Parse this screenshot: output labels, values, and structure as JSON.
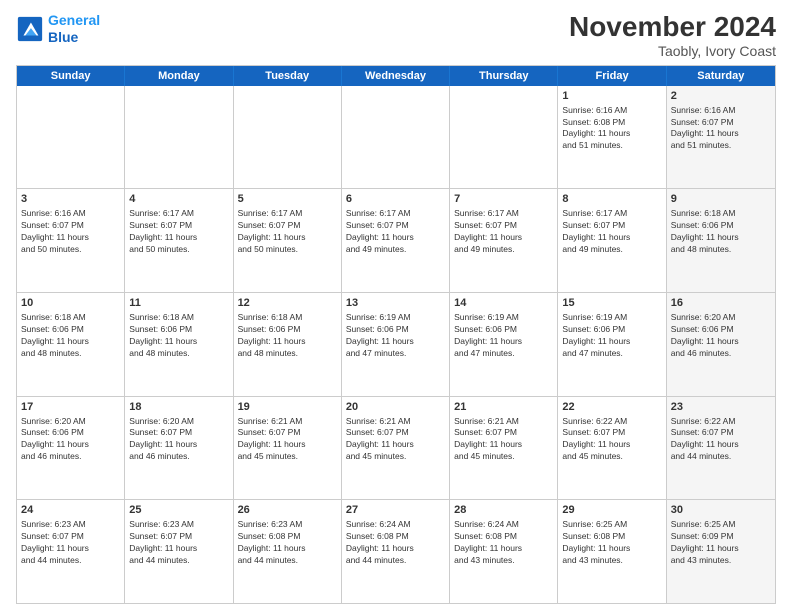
{
  "logo": {
    "line1": "General",
    "line2": "Blue"
  },
  "title": "November 2024",
  "subtitle": "Taobly, Ivory Coast",
  "weekdays": [
    "Sunday",
    "Monday",
    "Tuesday",
    "Wednesday",
    "Thursday",
    "Friday",
    "Saturday"
  ],
  "rows": [
    [
      {
        "day": "",
        "info": "",
        "shaded": false
      },
      {
        "day": "",
        "info": "",
        "shaded": false
      },
      {
        "day": "",
        "info": "",
        "shaded": false
      },
      {
        "day": "",
        "info": "",
        "shaded": false
      },
      {
        "day": "",
        "info": "",
        "shaded": false
      },
      {
        "day": "1",
        "info": "Sunrise: 6:16 AM\nSunset: 6:08 PM\nDaylight: 11 hours\nand 51 minutes.",
        "shaded": false
      },
      {
        "day": "2",
        "info": "Sunrise: 6:16 AM\nSunset: 6:07 PM\nDaylight: 11 hours\nand 51 minutes.",
        "shaded": true
      }
    ],
    [
      {
        "day": "3",
        "info": "Sunrise: 6:16 AM\nSunset: 6:07 PM\nDaylight: 11 hours\nand 50 minutes.",
        "shaded": false
      },
      {
        "day": "4",
        "info": "Sunrise: 6:17 AM\nSunset: 6:07 PM\nDaylight: 11 hours\nand 50 minutes.",
        "shaded": false
      },
      {
        "day": "5",
        "info": "Sunrise: 6:17 AM\nSunset: 6:07 PM\nDaylight: 11 hours\nand 50 minutes.",
        "shaded": false
      },
      {
        "day": "6",
        "info": "Sunrise: 6:17 AM\nSunset: 6:07 PM\nDaylight: 11 hours\nand 49 minutes.",
        "shaded": false
      },
      {
        "day": "7",
        "info": "Sunrise: 6:17 AM\nSunset: 6:07 PM\nDaylight: 11 hours\nand 49 minutes.",
        "shaded": false
      },
      {
        "day": "8",
        "info": "Sunrise: 6:17 AM\nSunset: 6:07 PM\nDaylight: 11 hours\nand 49 minutes.",
        "shaded": false
      },
      {
        "day": "9",
        "info": "Sunrise: 6:18 AM\nSunset: 6:06 PM\nDaylight: 11 hours\nand 48 minutes.",
        "shaded": true
      }
    ],
    [
      {
        "day": "10",
        "info": "Sunrise: 6:18 AM\nSunset: 6:06 PM\nDaylight: 11 hours\nand 48 minutes.",
        "shaded": false
      },
      {
        "day": "11",
        "info": "Sunrise: 6:18 AM\nSunset: 6:06 PM\nDaylight: 11 hours\nand 48 minutes.",
        "shaded": false
      },
      {
        "day": "12",
        "info": "Sunrise: 6:18 AM\nSunset: 6:06 PM\nDaylight: 11 hours\nand 48 minutes.",
        "shaded": false
      },
      {
        "day": "13",
        "info": "Sunrise: 6:19 AM\nSunset: 6:06 PM\nDaylight: 11 hours\nand 47 minutes.",
        "shaded": false
      },
      {
        "day": "14",
        "info": "Sunrise: 6:19 AM\nSunset: 6:06 PM\nDaylight: 11 hours\nand 47 minutes.",
        "shaded": false
      },
      {
        "day": "15",
        "info": "Sunrise: 6:19 AM\nSunset: 6:06 PM\nDaylight: 11 hours\nand 47 minutes.",
        "shaded": false
      },
      {
        "day": "16",
        "info": "Sunrise: 6:20 AM\nSunset: 6:06 PM\nDaylight: 11 hours\nand 46 minutes.",
        "shaded": true
      }
    ],
    [
      {
        "day": "17",
        "info": "Sunrise: 6:20 AM\nSunset: 6:06 PM\nDaylight: 11 hours\nand 46 minutes.",
        "shaded": false
      },
      {
        "day": "18",
        "info": "Sunrise: 6:20 AM\nSunset: 6:07 PM\nDaylight: 11 hours\nand 46 minutes.",
        "shaded": false
      },
      {
        "day": "19",
        "info": "Sunrise: 6:21 AM\nSunset: 6:07 PM\nDaylight: 11 hours\nand 45 minutes.",
        "shaded": false
      },
      {
        "day": "20",
        "info": "Sunrise: 6:21 AM\nSunset: 6:07 PM\nDaylight: 11 hours\nand 45 minutes.",
        "shaded": false
      },
      {
        "day": "21",
        "info": "Sunrise: 6:21 AM\nSunset: 6:07 PM\nDaylight: 11 hours\nand 45 minutes.",
        "shaded": false
      },
      {
        "day": "22",
        "info": "Sunrise: 6:22 AM\nSunset: 6:07 PM\nDaylight: 11 hours\nand 45 minutes.",
        "shaded": false
      },
      {
        "day": "23",
        "info": "Sunrise: 6:22 AM\nSunset: 6:07 PM\nDaylight: 11 hours\nand 44 minutes.",
        "shaded": true
      }
    ],
    [
      {
        "day": "24",
        "info": "Sunrise: 6:23 AM\nSunset: 6:07 PM\nDaylight: 11 hours\nand 44 minutes.",
        "shaded": false
      },
      {
        "day": "25",
        "info": "Sunrise: 6:23 AM\nSunset: 6:07 PM\nDaylight: 11 hours\nand 44 minutes.",
        "shaded": false
      },
      {
        "day": "26",
        "info": "Sunrise: 6:23 AM\nSunset: 6:08 PM\nDaylight: 11 hours\nand 44 minutes.",
        "shaded": false
      },
      {
        "day": "27",
        "info": "Sunrise: 6:24 AM\nSunset: 6:08 PM\nDaylight: 11 hours\nand 44 minutes.",
        "shaded": false
      },
      {
        "day": "28",
        "info": "Sunrise: 6:24 AM\nSunset: 6:08 PM\nDaylight: 11 hours\nand 43 minutes.",
        "shaded": false
      },
      {
        "day": "29",
        "info": "Sunrise: 6:25 AM\nSunset: 6:08 PM\nDaylight: 11 hours\nand 43 minutes.",
        "shaded": false
      },
      {
        "day": "30",
        "info": "Sunrise: 6:25 AM\nSunset: 6:09 PM\nDaylight: 11 hours\nand 43 minutes.",
        "shaded": true
      }
    ]
  ]
}
